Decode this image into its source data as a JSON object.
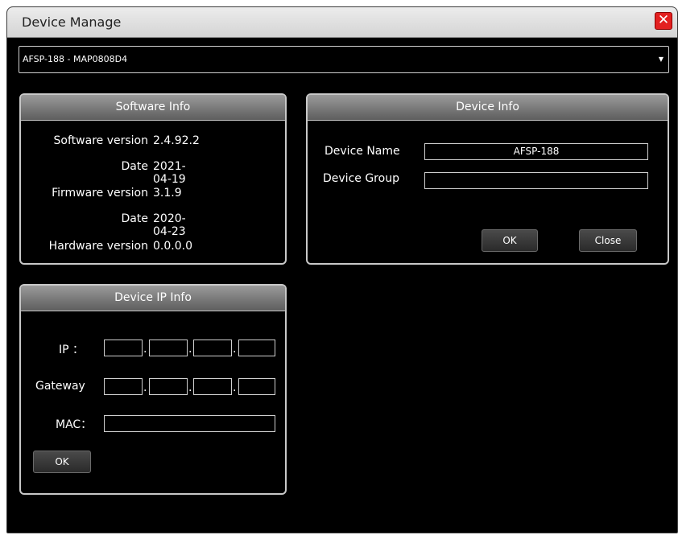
{
  "window": {
    "title": "Device Manage"
  },
  "device_selector": {
    "value": "AFSP-188 - MAP0808D4"
  },
  "software_info": {
    "header": "Software Info",
    "rows": [
      {
        "label": "Software version",
        "value": "2.4.92.2"
      },
      {
        "label": "Date",
        "value": "2021-04-19"
      },
      {
        "label": "Firmware version",
        "value": "3.1.9"
      },
      {
        "label": "Date",
        "value": "2020-04-23"
      },
      {
        "label": "Hardware version",
        "value": "0.0.0.0"
      }
    ]
  },
  "device_info": {
    "header": "Device Info",
    "name_label": "Device Name",
    "name_value": "AFSP-188",
    "group_label": "Device Group",
    "group_value": "",
    "ok_label": "OK",
    "close_label": "Close"
  },
  "ip_info": {
    "header": "Device IP Info",
    "ip_label": "IP ：",
    "gateway_label": "Gateway",
    "mac_label": "MAC：",
    "ip_octets": [
      "",
      "",
      "",
      ""
    ],
    "gateway_octets": [
      "",
      "",
      "",
      ""
    ],
    "mac_value": "",
    "ok_label": "OK",
    "dot": "."
  },
  "colors": {
    "background": "#000000",
    "close_button": "#e32020",
    "panel_header": "#7a7a7a"
  },
  "icons": {
    "close": "close-x-icon",
    "dropdown": "caret-down-icon"
  }
}
